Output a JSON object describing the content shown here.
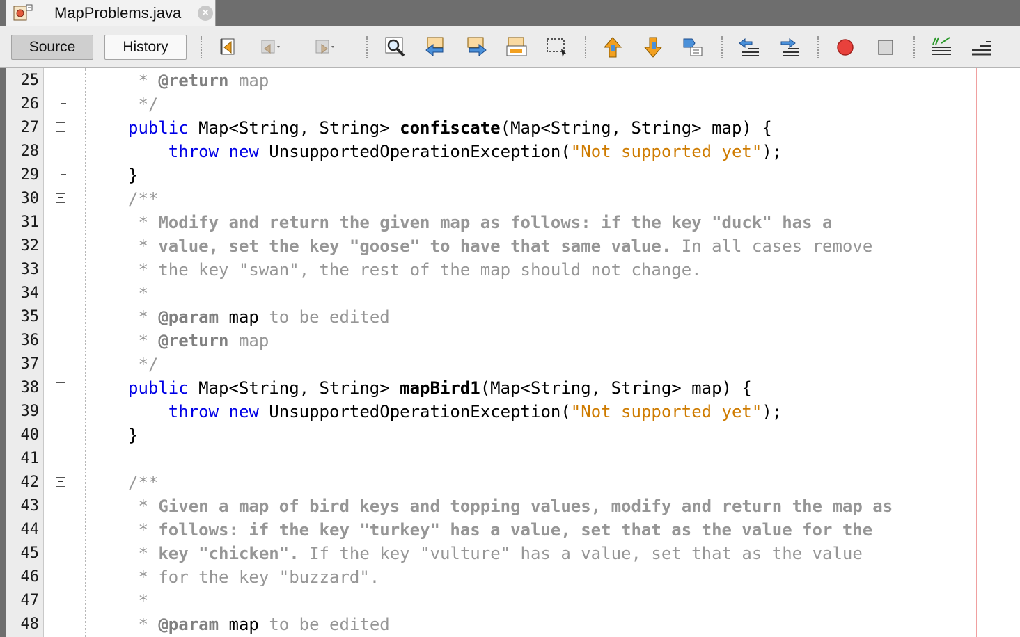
{
  "tab": {
    "title": "MapProblems.java",
    "close_glyph": "×"
  },
  "toolbar": {
    "source_label": "Source",
    "history_label": "History",
    "tools": [
      "last-edit-icon",
      "back-icon",
      "forward-icon",
      "find-icon",
      "find-previous-icon",
      "find-next-icon",
      "toggle-highlight-icon",
      "toggle-rectangular-selection-icon",
      "previous-bookmark-icon",
      "next-bookmark-icon",
      "toggle-bookmark-icon",
      "shift-left-icon",
      "shift-right-icon",
      "start-macro-recording-icon",
      "stop-macro-recording-icon",
      "comment-icon",
      "uncomment-icon"
    ]
  },
  "editor": {
    "lines": [
      {
        "num": "25",
        "tokens": [
          {
            "t": " * ",
            "c": "cm"
          },
          {
            "t": "@return",
            "c": "tag"
          },
          {
            "t": " map",
            "c": "cm"
          }
        ]
      },
      {
        "num": "26",
        "tokens": [
          {
            "t": " */",
            "c": "cm"
          }
        ]
      },
      {
        "num": "27",
        "tokens": [
          {
            "t": "public",
            "c": "kw"
          },
          {
            "t": " Map<String, String> ",
            "c": "plain"
          },
          {
            "t": "confiscate",
            "c": "bold"
          },
          {
            "t": "(Map<String, String> map) {",
            "c": "plain"
          }
        ]
      },
      {
        "num": "28",
        "tokens": [
          {
            "t": "    ",
            "c": "plain"
          },
          {
            "t": "throw",
            "c": "kw"
          },
          {
            "t": " ",
            "c": "plain"
          },
          {
            "t": "new",
            "c": "kw"
          },
          {
            "t": " UnsupportedOperationException(",
            "c": "plain"
          },
          {
            "t": "\"Not supported yet\"",
            "c": "str"
          },
          {
            "t": ");",
            "c": "plain"
          }
        ]
      },
      {
        "num": "29",
        "tokens": [
          {
            "t": "}",
            "c": "plain"
          }
        ]
      },
      {
        "num": "30",
        "tokens": [
          {
            "t": "/**",
            "c": "cm"
          }
        ]
      },
      {
        "num": "31",
        "tokens": [
          {
            "t": " * ",
            "c": "cm"
          },
          {
            "t": "Modify and return the given map as follows: if the key \"duck\" has a",
            "c": "cmb"
          }
        ]
      },
      {
        "num": "32",
        "tokens": [
          {
            "t": " * ",
            "c": "cm"
          },
          {
            "t": "value, set the key \"goose\" to have that same value.",
            "c": "cmb"
          },
          {
            "t": " In all cases remove",
            "c": "cm"
          }
        ]
      },
      {
        "num": "33",
        "tokens": [
          {
            "t": " * the key \"swan\", the rest of the map should not change.",
            "c": "cm"
          }
        ]
      },
      {
        "num": "34",
        "tokens": [
          {
            "t": " *",
            "c": "cm"
          }
        ]
      },
      {
        "num": "35",
        "tokens": [
          {
            "t": " * ",
            "c": "cm"
          },
          {
            "t": "@param",
            "c": "tag"
          },
          {
            "t": " ",
            "c": "cm"
          },
          {
            "t": "map",
            "c": "plain"
          },
          {
            "t": " to be edited",
            "c": "cm"
          }
        ]
      },
      {
        "num": "36",
        "tokens": [
          {
            "t": " * ",
            "c": "cm"
          },
          {
            "t": "@return",
            "c": "tag"
          },
          {
            "t": " map",
            "c": "cm"
          }
        ]
      },
      {
        "num": "37",
        "tokens": [
          {
            "t": " */",
            "c": "cm"
          }
        ]
      },
      {
        "num": "38",
        "tokens": [
          {
            "t": "public",
            "c": "kw"
          },
          {
            "t": " Map<String, String> ",
            "c": "plain"
          },
          {
            "t": "mapBird1",
            "c": "bold"
          },
          {
            "t": "(Map<String, String> map) {",
            "c": "plain"
          }
        ]
      },
      {
        "num": "39",
        "tokens": [
          {
            "t": "    ",
            "c": "plain"
          },
          {
            "t": "throw",
            "c": "kw"
          },
          {
            "t": " ",
            "c": "plain"
          },
          {
            "t": "new",
            "c": "kw"
          },
          {
            "t": " UnsupportedOperationException(",
            "c": "plain"
          },
          {
            "t": "\"Not supported yet\"",
            "c": "str"
          },
          {
            "t": ");",
            "c": "plain"
          }
        ]
      },
      {
        "num": "40",
        "tokens": [
          {
            "t": "}",
            "c": "plain"
          }
        ]
      },
      {
        "num": "41",
        "tokens": []
      },
      {
        "num": "42",
        "tokens": [
          {
            "t": "/**",
            "c": "cm"
          }
        ]
      },
      {
        "num": "43",
        "tokens": [
          {
            "t": " * ",
            "c": "cm"
          },
          {
            "t": "Given a map of bird keys and topping values, modify and return the map as",
            "c": "cmb"
          }
        ]
      },
      {
        "num": "44",
        "tokens": [
          {
            "t": " * ",
            "c": "cm"
          },
          {
            "t": "follows: if the key \"turkey\" has a value, set that as the value for the",
            "c": "cmb"
          }
        ]
      },
      {
        "num": "45",
        "tokens": [
          {
            "t": " * ",
            "c": "cm"
          },
          {
            "t": "key \"chicken\".",
            "c": "cmb"
          },
          {
            "t": " If the key \"vulture\" has a value, set that as the value",
            "c": "cm"
          }
        ]
      },
      {
        "num": "46",
        "tokens": [
          {
            "t": " * for the key \"buzzard\".",
            "c": "cm"
          }
        ]
      },
      {
        "num": "47",
        "tokens": [
          {
            "t": " *",
            "c": "cm"
          }
        ]
      },
      {
        "num": "48",
        "tokens": [
          {
            "t": " * ",
            "c": "cm"
          },
          {
            "t": "@param",
            "c": "tag"
          },
          {
            "t": " ",
            "c": "cm"
          },
          {
            "t": "map",
            "c": "plain"
          },
          {
            "t": " to be edited",
            "c": "cm"
          }
        ]
      }
    ]
  },
  "colors": {
    "keyword": "#0000e6",
    "string": "#ce7b00",
    "comment": "#969696",
    "right_margin": "#f0a0a0"
  }
}
